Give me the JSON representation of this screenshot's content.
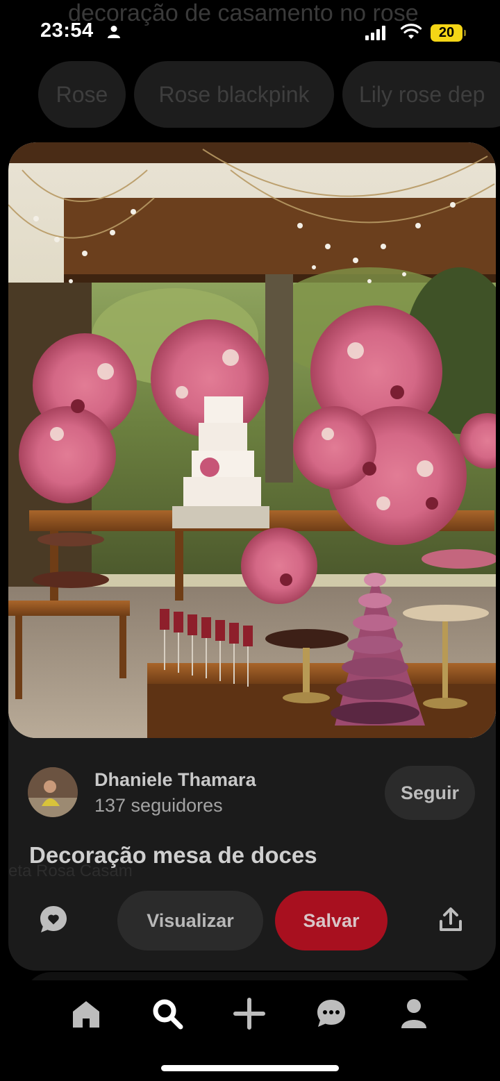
{
  "status_bar": {
    "time": "23:54",
    "battery": "20"
  },
  "background_page": {
    "search_query": "decoração de casamento no rose",
    "chips": [
      "Rose",
      "Rose blackpink",
      "Lily rose dep"
    ],
    "ghost_text": "eta Rosa Casam"
  },
  "pin": {
    "author": {
      "name": "Dhaniele Thamara",
      "followers": "137 seguidores"
    },
    "follow_label": "Seguir",
    "title": "Decoração mesa de doces",
    "view_label": "Visualizar",
    "save_label": "Salvar"
  },
  "bottom_nav": {
    "items": [
      "home-icon",
      "search-icon",
      "create-icon",
      "messages-icon",
      "profile-icon"
    ],
    "active": "search-icon"
  },
  "colors": {
    "save_button": "#a8101f",
    "background": "#000000",
    "card": "#1b1b1b",
    "battery": "#f4d516"
  }
}
